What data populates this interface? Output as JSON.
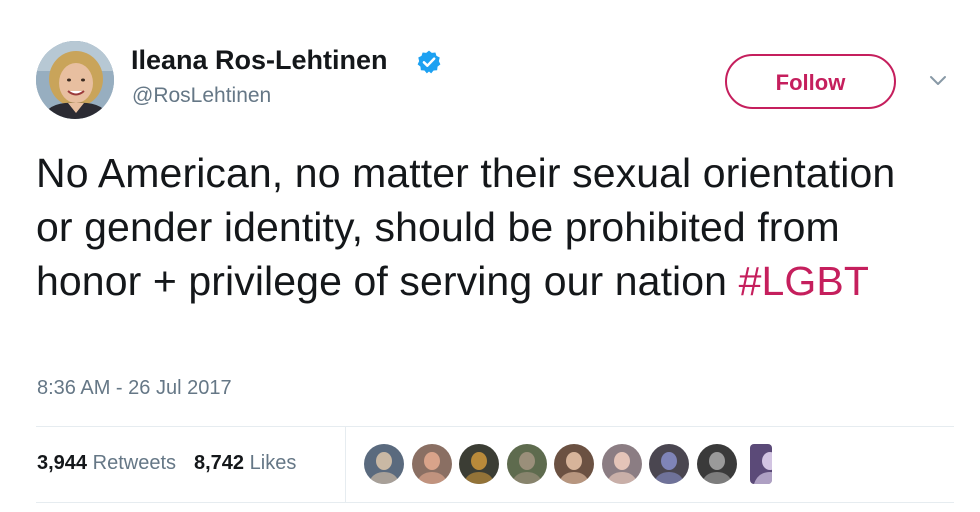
{
  "author": {
    "name": "Ileana Ros-Lehtinen",
    "handle": "@RosLehtinen",
    "verified": true,
    "avatar_icon": "profile-photo"
  },
  "follow_button": {
    "label": "Follow"
  },
  "tweet": {
    "text": "No American, no matter their sexual orientation or gender identity, should be prohibited from honor + privilege of serving our nation",
    "hashtag": "#LGBT",
    "timestamp": "8:36 AM - 26 Jul 2017"
  },
  "stats": {
    "retweets_count": "3,944",
    "retweets_label": "Retweets",
    "likes_count": "8,742",
    "likes_label": "Likes"
  },
  "liker_avatars": [
    {
      "name": "liker-avatar-1",
      "color": "#5a6a7e",
      "accent": "#c9b8a4"
    },
    {
      "name": "liker-avatar-2",
      "color": "#8a6f63",
      "accent": "#d9a38a"
    },
    {
      "name": "liker-avatar-3",
      "color": "#3b3d34",
      "accent": "#b98a3a"
    },
    {
      "name": "liker-avatar-4",
      "color": "#5e6b4e",
      "accent": "#9a8f7a"
    },
    {
      "name": "liker-avatar-5",
      "color": "#6b5142",
      "accent": "#d7b49a"
    },
    {
      "name": "liker-avatar-6",
      "color": "#8b7d83",
      "accent": "#e4c4b8"
    },
    {
      "name": "liker-avatar-7",
      "color": "#4a4650",
      "accent": "#7f84b8"
    },
    {
      "name": "liker-avatar-8",
      "color": "#3a3a3a",
      "accent": "#9a9a9a"
    },
    {
      "name": "liker-avatar-9",
      "color": "#5b4a78",
      "accent": "#d2c4e2"
    }
  ],
  "colors": {
    "accent": "#c51f5d",
    "verified": "#1da1f2",
    "muted_text": "#657786",
    "primary_text": "#14171a"
  }
}
